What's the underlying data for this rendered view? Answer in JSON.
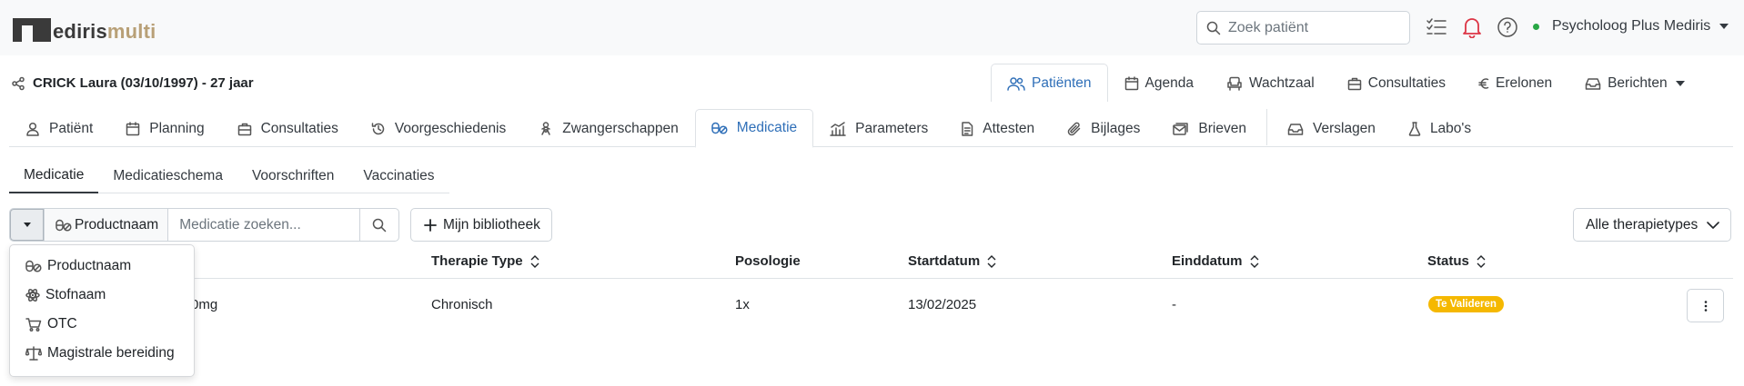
{
  "brand": {
    "logo_main": "ediris",
    "logo_accent": "multi"
  },
  "topbar": {
    "search_placeholder": "Zoek patiënt",
    "user_name": "Psycholoog Plus Mediris",
    "status_color": "#28a745"
  },
  "patient": {
    "label": "CRICK Laura (03/10/1997) - 27 jaar"
  },
  "main_tabs": [
    {
      "label": "Patiënten",
      "icon": "users-icon",
      "active": true
    },
    {
      "label": "Agenda",
      "icon": "calendar-icon"
    },
    {
      "label": "Wachtzaal",
      "icon": "armchair-icon"
    },
    {
      "label": "Consultaties",
      "icon": "briefcase-icon"
    },
    {
      "label": "Erelonen",
      "icon": "euro-icon"
    },
    {
      "label": "Berichten",
      "icon": "inbox-icon"
    }
  ],
  "sub_tabs": [
    {
      "label": "Patiënt",
      "icon": "user-icon"
    },
    {
      "label": "Planning",
      "icon": "calendar-icon"
    },
    {
      "label": "Consultaties",
      "icon": "briefcase-icon"
    },
    {
      "label": "Voorgeschiedenis",
      "icon": "history-icon"
    },
    {
      "label": "Zwangerschappen",
      "icon": "baby-icon"
    },
    {
      "label": "Medicatie",
      "icon": "pills-icon",
      "active": true
    },
    {
      "label": "Parameters",
      "icon": "chart-icon"
    },
    {
      "label": "Attesten",
      "icon": "document-icon"
    },
    {
      "label": "Bijlages",
      "icon": "paperclip-icon"
    },
    {
      "label": "Brieven",
      "icon": "envelope-icon"
    },
    {
      "label": "Verslagen",
      "icon": "inbox-icon"
    },
    {
      "label": "Labo's",
      "icon": "flask-icon"
    }
  ],
  "third_tabs": [
    {
      "label": "Medicatie",
      "active": true
    },
    {
      "label": "Medicatieschema"
    },
    {
      "label": "Voorschriften"
    },
    {
      "label": "Vaccinaties"
    }
  ],
  "toolbar": {
    "search_type": "Productnaam",
    "search_placeholder": "Medicatie zoeken...",
    "library_label": "Mijn bibliotheek",
    "therapy_filter": "Alle therapietypes"
  },
  "table": {
    "headers": [
      "Therapie Type",
      "Posologie",
      "Startdatum",
      "Einddatum",
      "Status"
    ],
    "rows": [
      {
        "name_visible": "0mg",
        "therapy": "Chronisch",
        "posology": "1x",
        "start": "13/02/2025",
        "end": "-",
        "status": "Te Valideren",
        "status_color": "#f5b800"
      }
    ]
  },
  "search_menu": {
    "items": [
      {
        "label": "Productnaam",
        "icon": "pills-icon"
      },
      {
        "label": "Stofnaam",
        "icon": "atom-icon"
      },
      {
        "label": "OTC",
        "icon": "cart-icon"
      },
      {
        "label": "Magistrale bereiding",
        "icon": "scale-icon"
      }
    ]
  },
  "colors": {
    "accent": "#2f6fb8",
    "logo_accent": "#b8a077"
  }
}
